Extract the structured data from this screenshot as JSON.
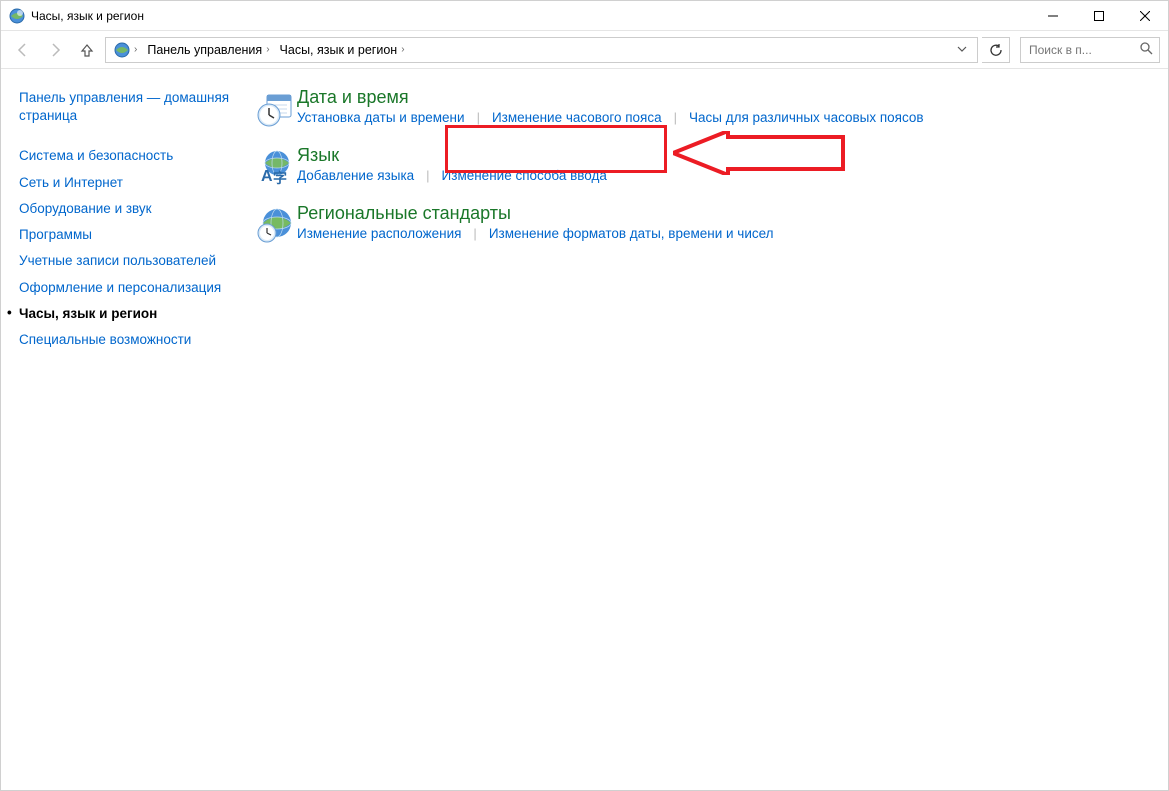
{
  "window": {
    "title": "Часы, язык и регион"
  },
  "breadcrumb": {
    "seg1": "Панель управления",
    "seg2": "Часы, язык и регион"
  },
  "search": {
    "placeholder": "Поиск в п..."
  },
  "sidebar": {
    "home": "Панель управления — домашняя страница",
    "items": [
      "Система и безопасность",
      "Сеть и Интернет",
      "Оборудование и звук",
      "Программы",
      "Учетные записи пользователей",
      "Оформление и персонализация",
      "Часы, язык и регион",
      "Специальные возможности"
    ],
    "active_index": 6
  },
  "sections": [
    {
      "icon": "clock-calendar-icon",
      "title": "Дата и время",
      "links": [
        "Установка даты и времени",
        "Изменение часового пояса",
        "Часы для различных часовых поясов"
      ]
    },
    {
      "icon": "language-globe-icon",
      "title": "Язык",
      "links": [
        "Добавление языка",
        "Изменение способа ввода"
      ]
    },
    {
      "icon": "globe-region-icon",
      "title": "Региональные стандарты",
      "links": [
        "Изменение расположения",
        "Изменение форматов даты, времени и чисел"
      ]
    }
  ]
}
